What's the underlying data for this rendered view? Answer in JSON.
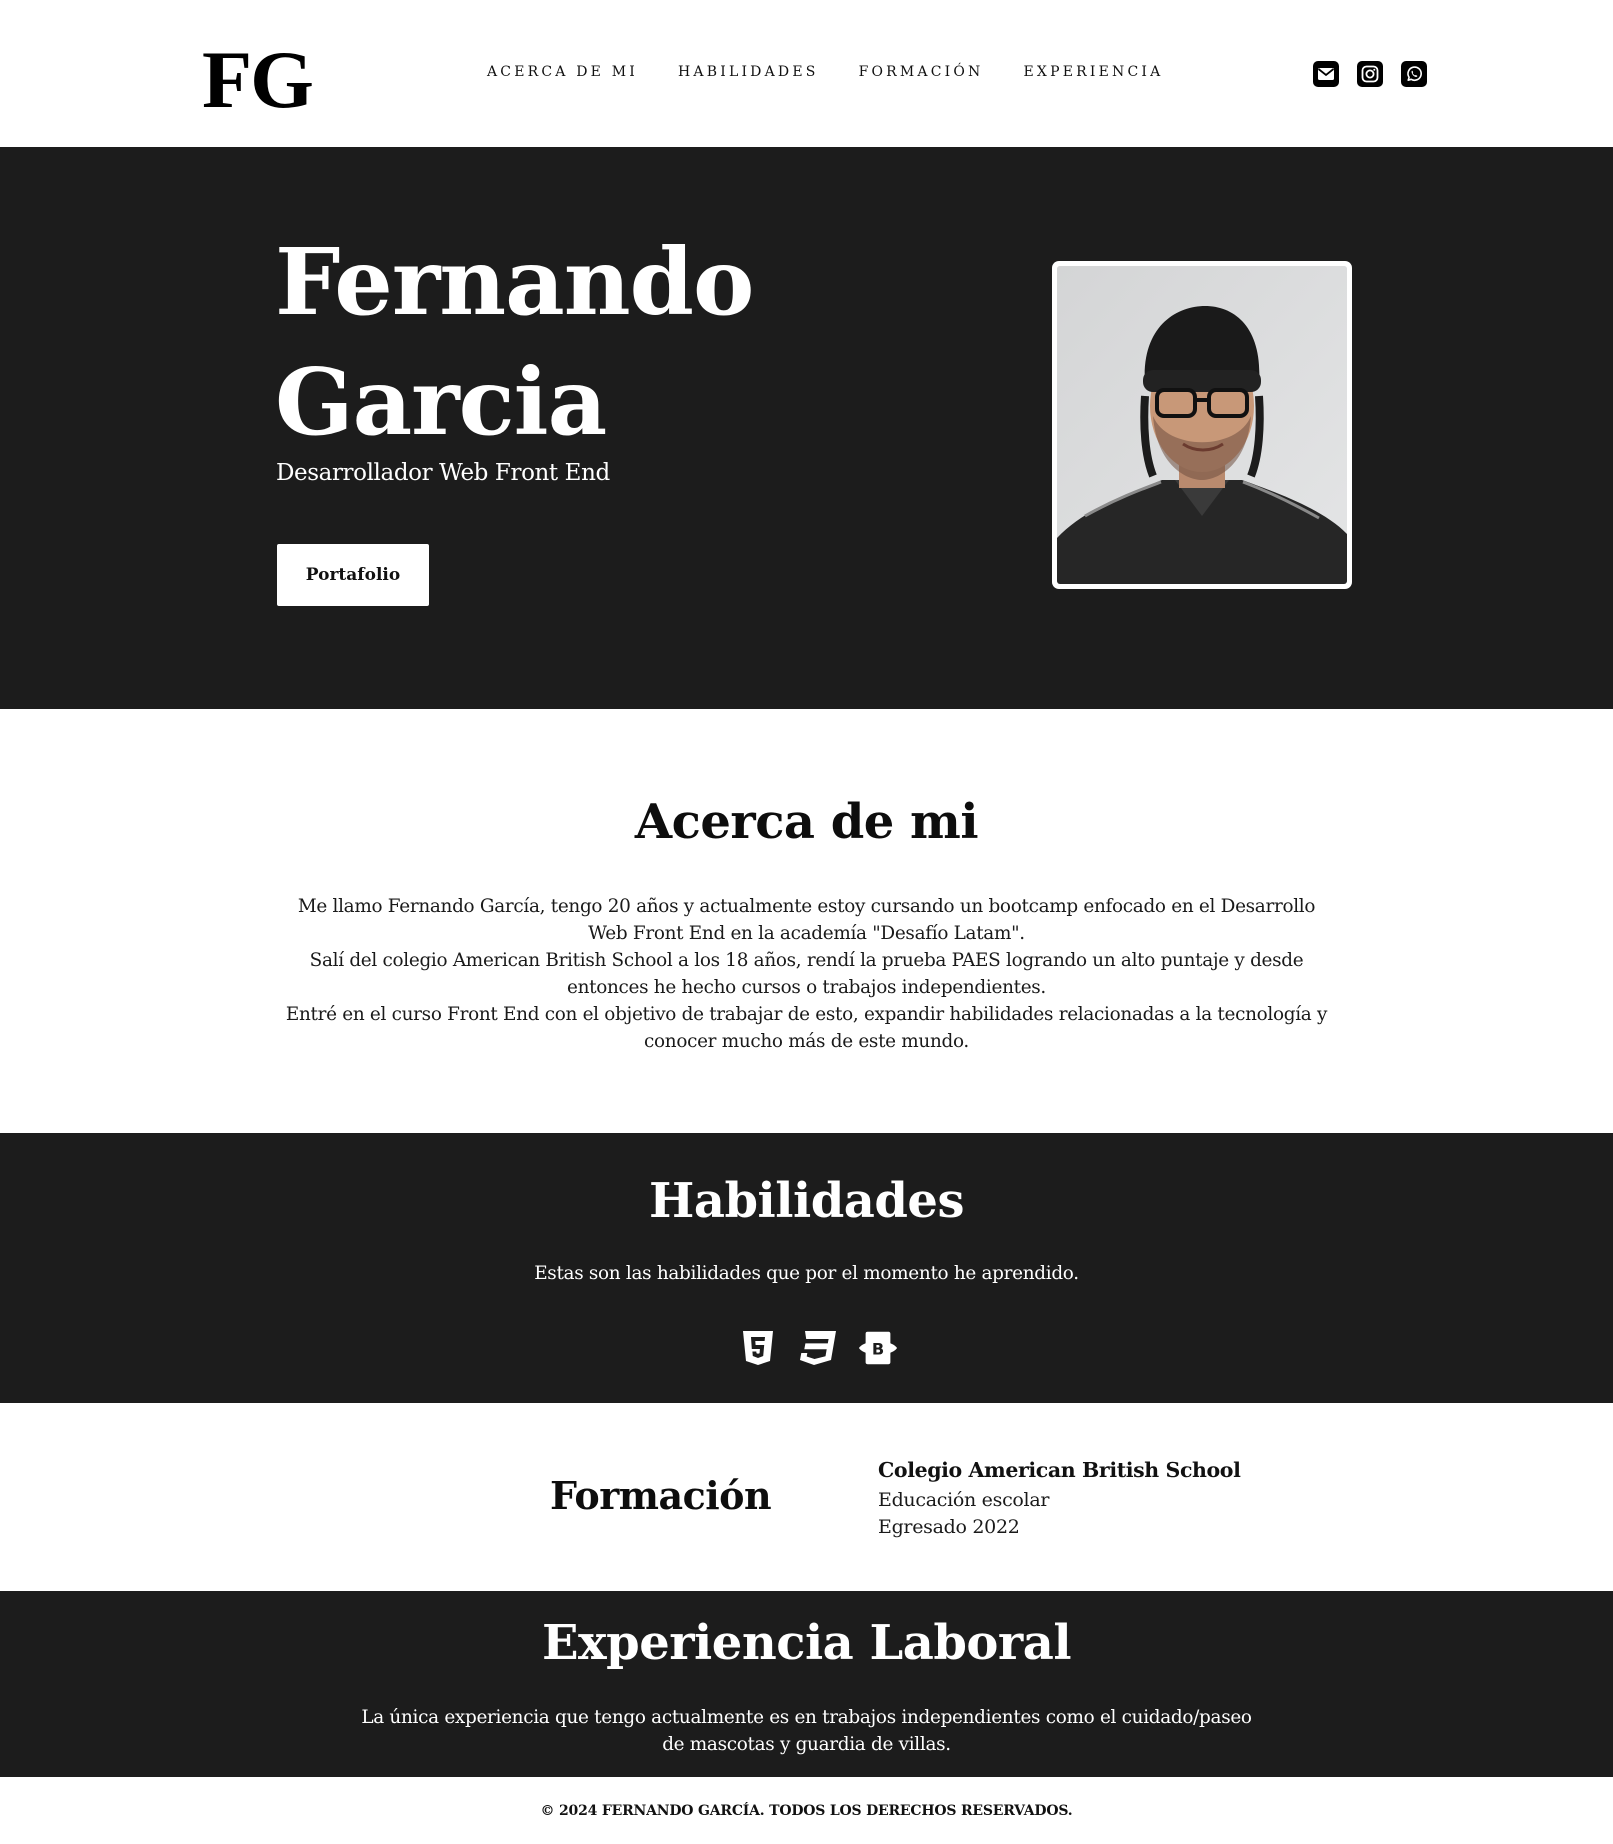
{
  "header": {
    "logo": "FG",
    "nav": [
      "ACERCA DE MI",
      "HABILIDADES",
      "FORMACIÓN",
      "EXPERIENCIA"
    ],
    "socials": [
      "mail-icon",
      "instagram-icon",
      "whatsapp-icon"
    ]
  },
  "hero": {
    "name_line1": "Fernando",
    "name_line2": "Garcia",
    "role": "Desarrollador Web Front End",
    "button": "Portafolio",
    "photo_icon": "profile-photo"
  },
  "about": {
    "title": "Acerca de mi",
    "paragraph1": "Me llamo Fernando García, tengo 20 años y actualmente estoy cursando un bootcamp enfocado en el Desarrollo Web Front End en la academía \"Desafío Latam\".",
    "paragraph2": "Salí del colegio American British School a los 18 años, rendí la prueba PAES logrando un alto puntaje y desde entonces he hecho cursos o trabajos independientes.",
    "paragraph3": "Entré en el curso Front End con el objetivo de trabajar de esto, expandir habilidades relacionadas a la tecnología y conocer mucho más de este mundo."
  },
  "skills": {
    "title": "Habilidades",
    "text": "Estas son las habilidades que por el momento he aprendido.",
    "icons": [
      "html5-icon",
      "css3-icon",
      "bootstrap-icon"
    ]
  },
  "formation": {
    "title": "Formación",
    "school": "Colegio American British School",
    "level": "Educación escolar",
    "graduated": "Egresado 2022"
  },
  "experience": {
    "title": "Experiencia Laboral",
    "text": "La única experiencia que tengo actualmente es en trabajos independientes como el cuidado/paseo de mascotas y guardia de villas."
  },
  "footer": {
    "text": "© 2024 FERNANDO GARCÍA. TODOS LOS DERECHOS RESERVADOS."
  },
  "colors": {
    "dark_bg": "#1c1c1c",
    "light_bg": "#ffffff",
    "text_dark": "#111111"
  }
}
